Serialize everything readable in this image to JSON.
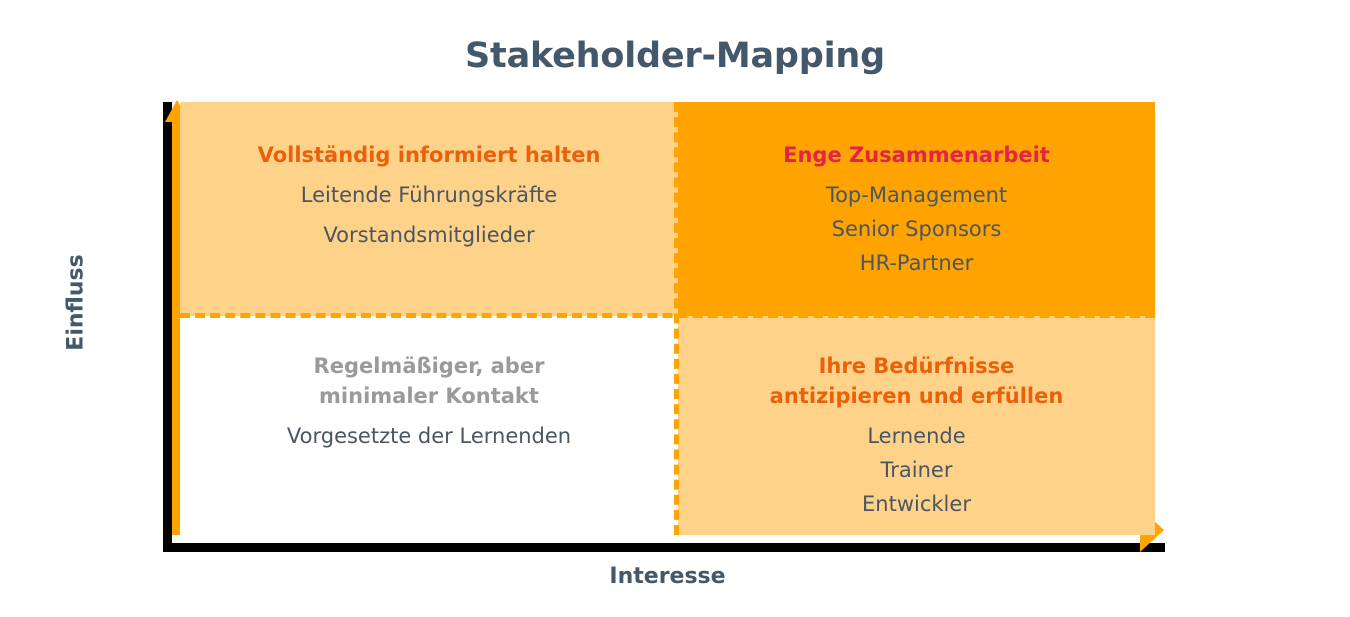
{
  "title": "Stakeholder-Mapping",
  "axes": {
    "y_label": "Einfluss",
    "x_label": "Interesse"
  },
  "colors": {
    "title_text": "#44586B",
    "quadrant_light": "#FFD28A",
    "quadrant_strong": "#FFA100",
    "quadrant_white": "#FFFFFF",
    "axis_line": "#FFA300",
    "axis_shadow": "#000000",
    "heading_orange": "#E8620C",
    "heading_red": "#E0244A",
    "heading_grey": "#9A9A9A",
    "item_text": "#4A5662"
  },
  "chart_data": {
    "type": "table",
    "title": "Stakeholder-Mapping",
    "xlabel": "Interesse",
    "ylabel": "Einfluss",
    "quadrants": [
      {
        "position": "top-left",
        "interest": "niedrig",
        "influence": "hoch",
        "strategy": "Vollständig informiert halten",
        "strategy_color": "#E8620C",
        "background": "#FFD28A",
        "stakeholders": [
          "Leitende Führungskräfte",
          "Vorstandsmitglieder"
        ]
      },
      {
        "position": "top-right",
        "interest": "hoch",
        "influence": "hoch",
        "strategy": "Enge Zusammenarbeit",
        "strategy_color": "#E0244A",
        "background": "#FFA100",
        "stakeholders": [
          "Top-Management",
          "Senior Sponsors",
          "HR-Partner"
        ]
      },
      {
        "position": "bottom-left",
        "interest": "niedrig",
        "influence": "niedrig",
        "strategy": "Regelmäßiger, aber\nminimaler Kontakt",
        "strategy_color": "#9A9A9A",
        "background": "#FFFFFF",
        "stakeholders": [
          "Vorgesetzte der Lernenden"
        ]
      },
      {
        "position": "bottom-right",
        "interest": "hoch",
        "influence": "niedrig",
        "strategy": "Ihre Bedürfnisse\nantizipieren und erfüllen",
        "strategy_color": "#E8620C",
        "background": "#FFD28A",
        "stakeholders": [
          "Lernende",
          "Trainer",
          "Entwickler"
        ]
      }
    ]
  }
}
